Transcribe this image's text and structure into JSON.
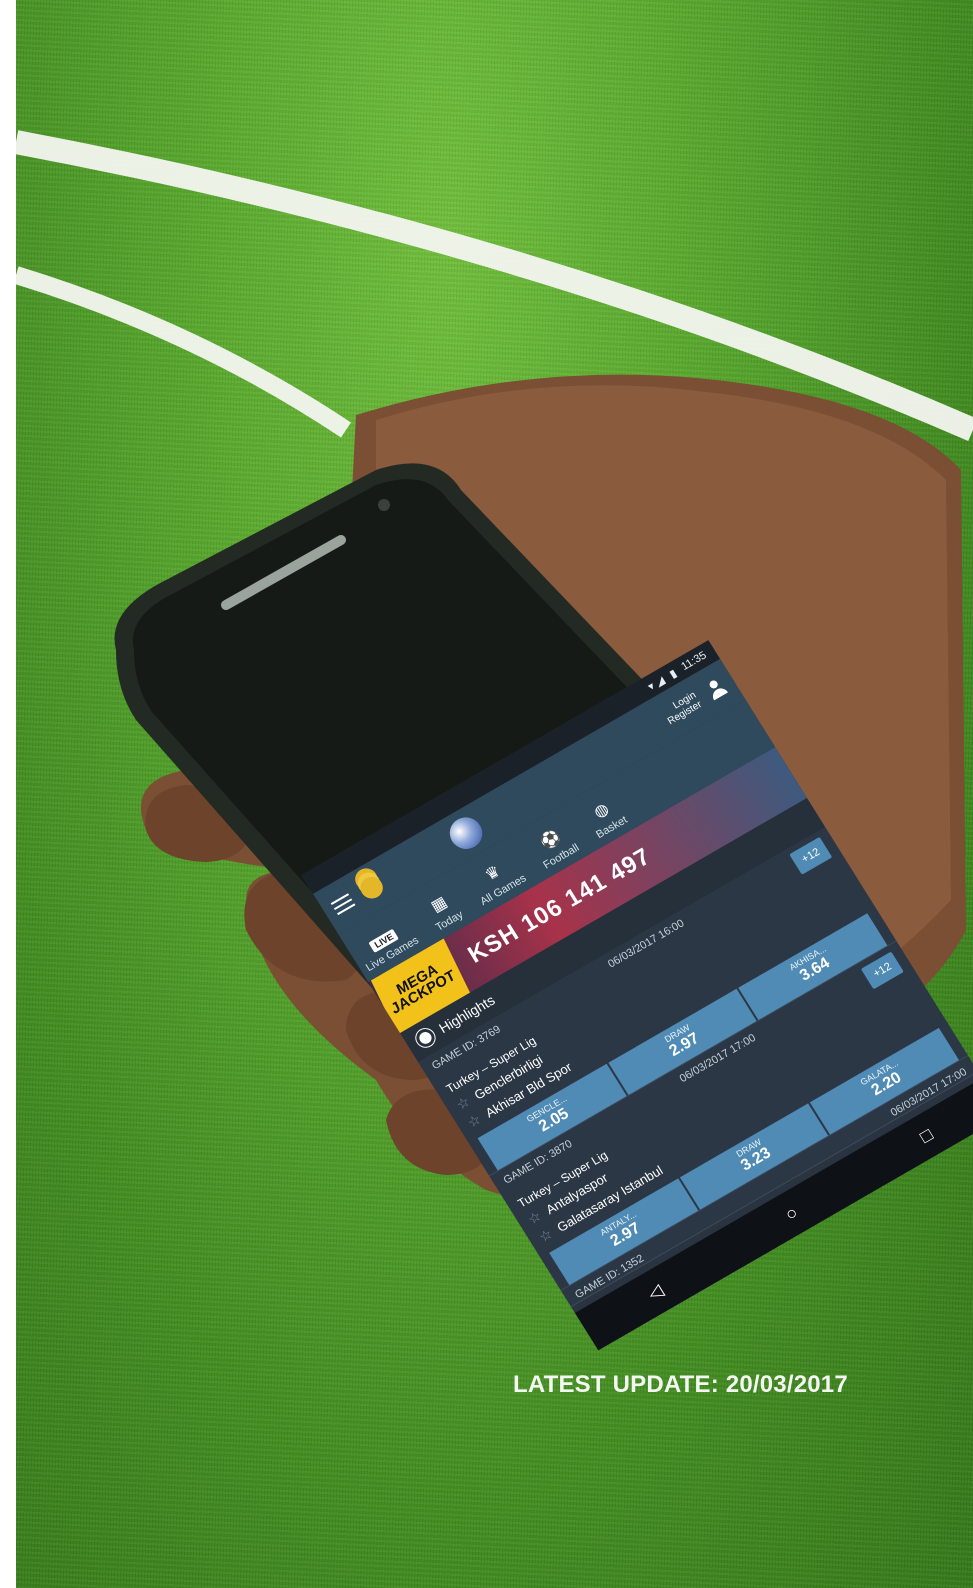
{
  "caption": "LATEST UPDATE: 20/03/2017",
  "phone": {
    "status_time": "11:35",
    "auth": {
      "login": "Login",
      "register": "Register"
    },
    "nav": [
      {
        "label": "Live Games",
        "badge": "LIVE"
      },
      {
        "label": "Today"
      },
      {
        "label": "All Games"
      },
      {
        "label": "Football"
      },
      {
        "label": "Basket"
      }
    ],
    "banner": {
      "mega_line1": "MEGA",
      "mega_line2": "JACKPOT",
      "amount": "KSH 106 141 497"
    },
    "section_title": "Highlights",
    "games": [
      {
        "game_id": "GAME ID: 3769",
        "league": "Turkey – Super Lig",
        "home": "Genclerbirligi",
        "away": "Akhisar Bld Spor",
        "datetime": "06/03/2017 16:00",
        "more": "+12",
        "odds": [
          {
            "label": "GENCLE...",
            "value": "2.05"
          },
          {
            "label": "DRAW",
            "value": "2.97"
          },
          {
            "label": "AKHISA...",
            "value": "3.64"
          }
        ]
      },
      {
        "game_id": "GAME ID: 3870",
        "league": "Turkey – Super Lig",
        "home": "Antalyaspor",
        "away": "Galatasaray Istanbul",
        "datetime": "06/03/2017 17:00",
        "more": "+12",
        "odds": [
          {
            "label": "ANTALY...",
            "value": "2.97"
          },
          {
            "label": "DRAW",
            "value": "3.23"
          },
          {
            "label": "GALATA...",
            "value": "2.20"
          }
        ]
      }
    ],
    "next_game_id": "GAME ID: 1352",
    "next_datetime": "06/03/2017 17:00"
  },
  "colors": {
    "grass": "#55a52a",
    "screen_bg": "#2a3340",
    "accent_blue": "#4f8bb5",
    "jackpot_yellow": "#f2c21b"
  }
}
